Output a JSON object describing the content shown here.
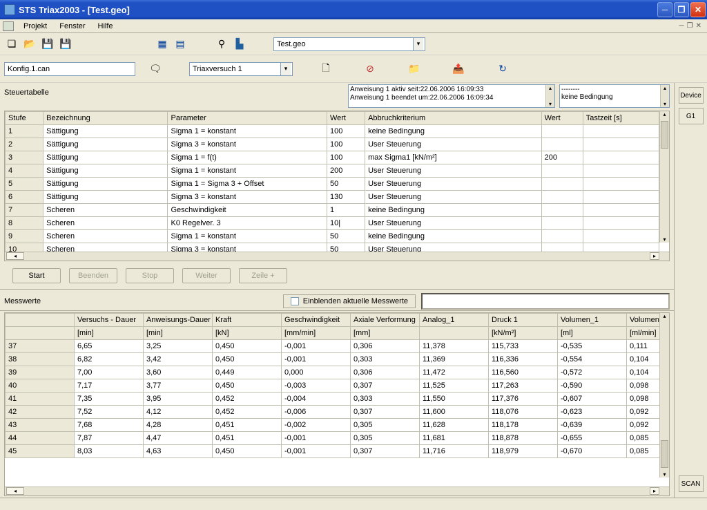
{
  "window": {
    "title": "STS Triax2003 - [Test.geo]"
  },
  "menu": {
    "projekt": "Projekt",
    "fenster": "Fenster",
    "hilfe": "Hilfe"
  },
  "toolbar1": {
    "file_combo": "Test.geo"
  },
  "toolbar2": {
    "config_field": "Konfig.1.can",
    "experiment_combo": "Triaxversuch 1"
  },
  "right": {
    "device": "Device",
    "g1": "G1",
    "scan": "SCAN"
  },
  "info": {
    "label": "Steuertabelle",
    "log_line1": "Anweisung 1 aktiv seit:22.06.2006 16:09:33",
    "log_line2": "Anweisung 1 beendet um:22.06.2006 16:09:34",
    "cond_line1": "--------",
    "cond_line2": "keine Bedingung"
  },
  "grid1": {
    "headers": [
      "Stufe",
      "Bezeichnung",
      "Parameter",
      "Wert",
      "Abbruchkriterium",
      "Wert",
      "Tastzeit [s]"
    ],
    "rows": [
      [
        "1",
        "Sättigung",
        "Sigma 1 = konstant",
        "100",
        "keine Bedingung",
        "",
        ""
      ],
      [
        "2",
        "Sättigung",
        "Sigma 3 = konstant",
        "100",
        "User Steuerung",
        "",
        ""
      ],
      [
        "3",
        "Sättigung",
        "Sigma 1 = f(t)",
        "100",
        "max Sigma1 [kN/m²]",
        "200",
        ""
      ],
      [
        "4",
        "Sättigung",
        "Sigma 1 = konstant",
        "200",
        "User Steuerung",
        "",
        ""
      ],
      [
        "5",
        "Sättigung",
        "Sigma 1 = Sigma 3 + Offset",
        "50",
        "User Steuerung",
        "",
        ""
      ],
      [
        "6",
        "Sättigung",
        "Sigma 3 = konstant",
        "130",
        "User Steuerung",
        "",
        ""
      ],
      [
        "7",
        "Scheren",
        "Geschwindigkeit",
        "1",
        "keine Bedingung",
        "",
        ""
      ],
      [
        "8",
        "Scheren",
        "K0 Regelver. 3",
        "10|",
        "User Steuerung",
        "",
        ""
      ],
      [
        "9",
        "Scheren",
        "Sigma 1 = konstant",
        "50",
        "keine Bedingung",
        "",
        ""
      ],
      [
        "10",
        "Scheren",
        "Sigma 3 = konstant",
        "50",
        "User Steuerung",
        "",
        ""
      ]
    ]
  },
  "buttons": {
    "start": "Start",
    "beenden": "Beenden",
    "stop": "Stop",
    "weiter": "Weiter",
    "zeile": "Zeile +"
  },
  "mess": {
    "label": "Messwerte",
    "checkbox": "Einblenden aktuelle Messwerte"
  },
  "grid2": {
    "headers": [
      "",
      "Versuchs - Dauer",
      "Anweisungs-Dauer",
      "Kraft",
      "Geschwindigkeit",
      "Axiale Verformung",
      "Analog_1",
      "Druck 1",
      "Volumen_1",
      "Volumen"
    ],
    "units": [
      "",
      "[min]",
      "[min]",
      "[kN]",
      "[mm/min]",
      "[mm]",
      "",
      "[kN/m²]",
      "[ml]",
      "[ml/min]"
    ],
    "rows": [
      [
        "37",
        "6,65",
        "3,25",
        "0,450",
        "-0,001",
        "0,306",
        "11,378",
        "115,733",
        "-0,535",
        "0,111"
      ],
      [
        "38",
        "6,82",
        "3,42",
        "0,450",
        "-0,001",
        "0,303",
        "11,369",
        "116,336",
        "-0,554",
        "0,104"
      ],
      [
        "39",
        "7,00",
        "3,60",
        "0,449",
        "0,000",
        "0,306",
        "11,472",
        "116,560",
        "-0,572",
        "0,104"
      ],
      [
        "40",
        "7,17",
        "3,77",
        "0,450",
        "-0,003",
        "0,307",
        "11,525",
        "117,263",
        "-0,590",
        "0,098"
      ],
      [
        "41",
        "7,35",
        "3,95",
        "0,452",
        "-0,004",
        "0,303",
        "11,550",
        "117,376",
        "-0,607",
        "0,098"
      ],
      [
        "42",
        "7,52",
        "4,12",
        "0,452",
        "-0,006",
        "0,307",
        "11,600",
        "118,076",
        "-0,623",
        "0,092"
      ],
      [
        "43",
        "7,68",
        "4,28",
        "0,451",
        "-0,002",
        "0,305",
        "11,628",
        "118,178",
        "-0,639",
        "0,092"
      ],
      [
        "44",
        "7,87",
        "4,47",
        "0,451",
        "-0,001",
        "0,305",
        "11,681",
        "118,878",
        "-0,655",
        "0,085"
      ],
      [
        "45",
        "8,03",
        "4,63",
        "0,450",
        "-0,001",
        "0,307",
        "11,716",
        "118,979",
        "-0,670",
        "0,085"
      ]
    ]
  },
  "colwidths1": [
    55,
    180,
    230,
    55,
    255,
    60,
    110
  ],
  "colwidths2": [
    100,
    100,
    100,
    100,
    100,
    100,
    100,
    100,
    100,
    70
  ]
}
